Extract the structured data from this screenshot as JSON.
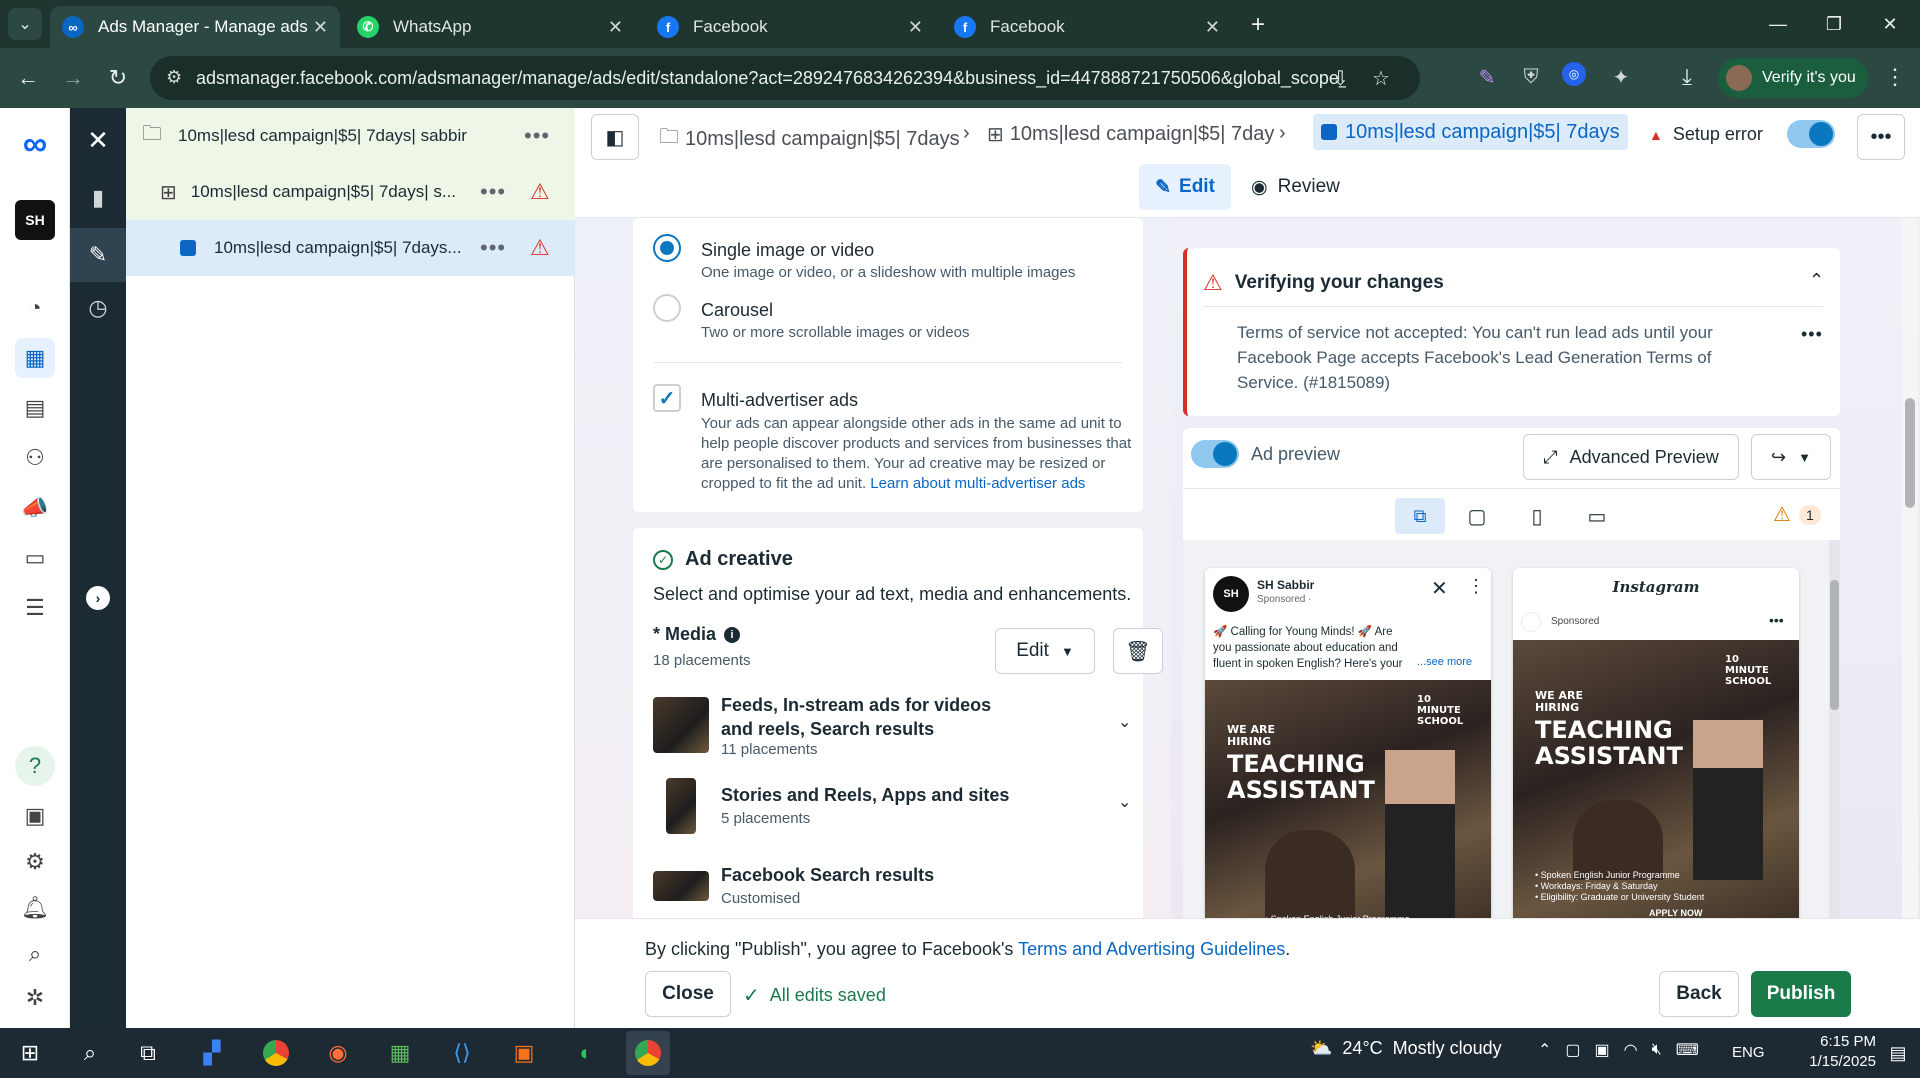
{
  "browser": {
    "tabs": [
      {
        "title": "Ads Manager - Manage ads - A",
        "icon": "meta-ads-icon",
        "active": true
      },
      {
        "title": "WhatsApp",
        "icon": "whatsapp-icon",
        "active": false
      },
      {
        "title": "Facebook",
        "icon": "facebook-icon",
        "active": false
      },
      {
        "title": "Facebook",
        "icon": "facebook-icon",
        "active": false
      }
    ],
    "url": "adsmanager.facebook.com/adsmanager/manage/ads/edit/standalone?act=2892476834262394&business_id=447888721750506&global_scope_id=4...",
    "profile_label": "Verify it's you"
  },
  "tree": {
    "campaign": "10ms|lesd campaign|$5| 7days| sabbir",
    "adset": "10ms|lesd campaign|$5| 7days| s...",
    "ad": "10ms|lesd campaign|$5| 7days..."
  },
  "header": {
    "crumb_campaign": "10ms|lesd campaign|$5| 7days",
    "crumb_adset": "10ms|lesd campaign|$5| 7day",
    "crumb_ad": "10ms|lesd campaign|$5| 7days",
    "setup_error": "Setup error",
    "edit_tab": "Edit",
    "review_tab": "Review"
  },
  "format": {
    "single_title": "Single image or video",
    "single_sub": "One image or video, or a slideshow with multiple images",
    "carousel_title": "Carousel",
    "carousel_sub": "Two or more scrollable images or videos",
    "multi_title": "Multi-advertiser ads",
    "multi_desc": "Your ads can appear alongside other ads in the same ad unit to help people discover products and services from businesses that are personalised to them. Your ad creative may be resized or cropped to fit the ad unit.",
    "multi_link": "Learn about multi-advertiser ads"
  },
  "creative": {
    "title": "Ad creative",
    "subtitle": "Select and optimise your ad text, media and enhancements.",
    "media_label": "* Media",
    "placements_count": "18 placements",
    "edit_button": "Edit",
    "placements": [
      {
        "title": "Feeds, In-stream ads for videos and reels, Search results",
        "sub": "11 placements"
      },
      {
        "title": "Stories and Reels, Apps and sites",
        "sub": "5 placements"
      },
      {
        "title": "Facebook Search results",
        "sub": "Customised"
      }
    ]
  },
  "verify": {
    "title": "Verifying your changes",
    "message": "Terms of service not accepted: You can't run lead ads until your Facebook Page accepts Facebook's Lead Generation Terms of Service. (#1815089)"
  },
  "preview": {
    "toggle_label": "Ad preview",
    "advanced_button": "Advanced Preview",
    "warning_count": "1",
    "fb_ad": {
      "page_name": "SH Sabbir",
      "sponsored": "Sponsored · ",
      "text": "🚀 Calling for Young Minds! 🚀 Are you passionate about education and fluent in spoken English? Here's your",
      "see_more": "...see more",
      "brand": "10 MINUTE SCHOOL",
      "hiring": "WE ARE HIRING",
      "headline1": "TEACHING",
      "headline2": "ASSISTANT",
      "footer_line": "• Spoken English Junior Programme"
    },
    "ig_ad": {
      "logo": "Instagram",
      "sponsored": "Sponsored",
      "brand": "10 MINUTE SCHOOL",
      "hiring": "WE ARE HIRING",
      "headline1": "TEACHING",
      "headline2": "ASSISTANT",
      "bullets": [
        "• Spoken English Junior Programme",
        "• Workdays: Friday & Saturday",
        "• Eligibility: Graduate or University Student"
      ],
      "apply": "APPLY NOW"
    }
  },
  "footer": {
    "terms_prefix": "By clicking \"Publish\", you agree to Facebook's ",
    "terms_link": "Terms and Advertising Guidelines",
    "terms_suffix": ".",
    "close": "Close",
    "saved": "All edits saved",
    "back": "Back",
    "publish": "Publish"
  },
  "taskbar": {
    "weather": "24°C  Mostly cloudy",
    "lang": "ENG",
    "time": "6:15 PM",
    "date": "1/15/2025"
  },
  "colors": {
    "publish": "#1b7a4a",
    "accent": "#0a78be",
    "error": "#d93025"
  }
}
